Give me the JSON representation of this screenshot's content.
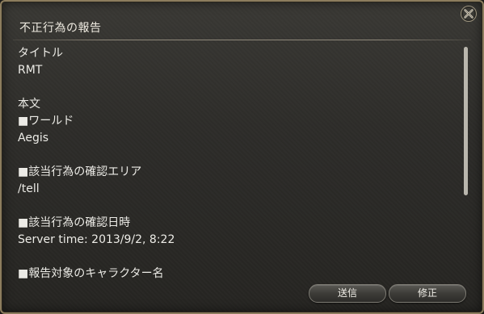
{
  "window": {
    "title": "不正行為の報告"
  },
  "report": {
    "title_label": "タイトル",
    "title_value": "RMT",
    "body_label": "本文",
    "sections": [
      {
        "heading": "■ワールド",
        "value": "Aegis"
      },
      {
        "heading": "■該当行為の確認エリア",
        "value": "/tell"
      },
      {
        "heading": "■該当行為の確認日時",
        "value": "Server time: 2013/9/2, 8:22"
      },
      {
        "heading": "■報告対象のキャラクター名",
        "value": ""
      }
    ]
  },
  "buttons": {
    "send_label": "送信",
    "edit_label": "修正"
  },
  "colors": {
    "border": "#8c7d5e",
    "text": "#ecebe6",
    "panel": "#2e2d2a"
  },
  "icons": {
    "close": "close-icon"
  }
}
